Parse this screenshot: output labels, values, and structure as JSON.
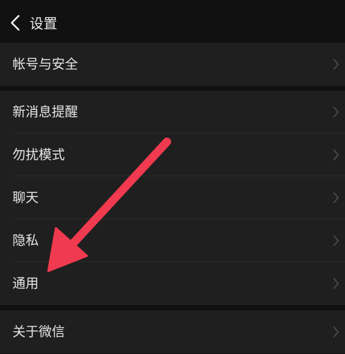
{
  "header": {
    "title": "设置",
    "back_icon": "chevron-left-icon"
  },
  "groups": [
    {
      "items": [
        {
          "label": "帐号与安全"
        }
      ]
    },
    {
      "items": [
        {
          "label": "新消息提醒"
        },
        {
          "label": "勿扰模式"
        },
        {
          "label": "聊天"
        },
        {
          "label": "隐私"
        },
        {
          "label": "通用"
        }
      ]
    },
    {
      "items": [
        {
          "label": "关于微信"
        }
      ]
    }
  ],
  "annotation": {
    "icon": "arrow-annotation-icon",
    "color": "#f03a4f"
  },
  "colors": {
    "background": "#111111",
    "row_background": "#1f1f1f",
    "text": "#e6e6e6",
    "chevron": "#4a4a4a"
  }
}
